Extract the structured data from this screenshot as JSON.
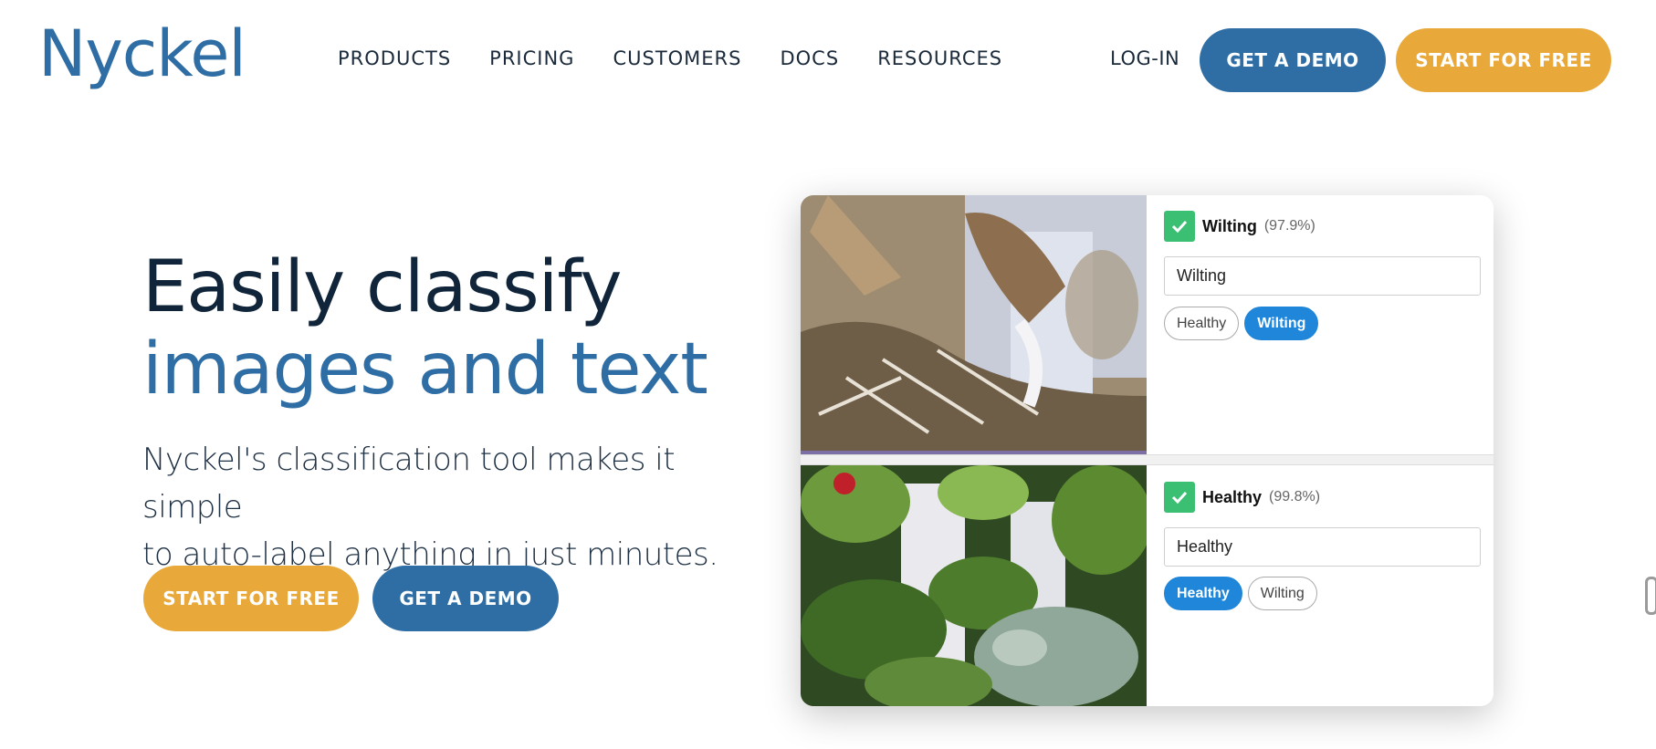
{
  "header": {
    "logo": "Nyckel",
    "nav": [
      "PRODUCTS",
      "PRICING",
      "CUSTOMERS",
      "DOCS",
      "RESOURCES"
    ],
    "login": "LOG-IN",
    "demo_button": "GET A DEMO",
    "start_button": "START FOR FREE"
  },
  "hero": {
    "title_line1": "Easily classify",
    "title_line2": "images and text",
    "subtitle_line1": "Nyckel's classification tool makes it simple",
    "subtitle_line2": "to auto-label anything in just minutes.",
    "start_button": "START FOR FREE",
    "demo_button": "GET A DEMO"
  },
  "demo_card": {
    "rows": [
      {
        "prediction": "Wilting",
        "confidence": "(97.9%)",
        "field_value": "Wilting",
        "tags": [
          {
            "label": "Healthy",
            "selected": false
          },
          {
            "label": "Wilting",
            "selected": true
          }
        ]
      },
      {
        "prediction": "Healthy",
        "confidence": "(99.8%)",
        "field_value": "Healthy",
        "tags": [
          {
            "label": "Healthy",
            "selected": true
          },
          {
            "label": "Wilting",
            "selected": false
          }
        ]
      }
    ]
  },
  "colors": {
    "brand_blue": "#2f6ea5",
    "brand_orange": "#e8a93a",
    "tag_blue": "#1f86d9",
    "check_green": "#3bbf72"
  }
}
